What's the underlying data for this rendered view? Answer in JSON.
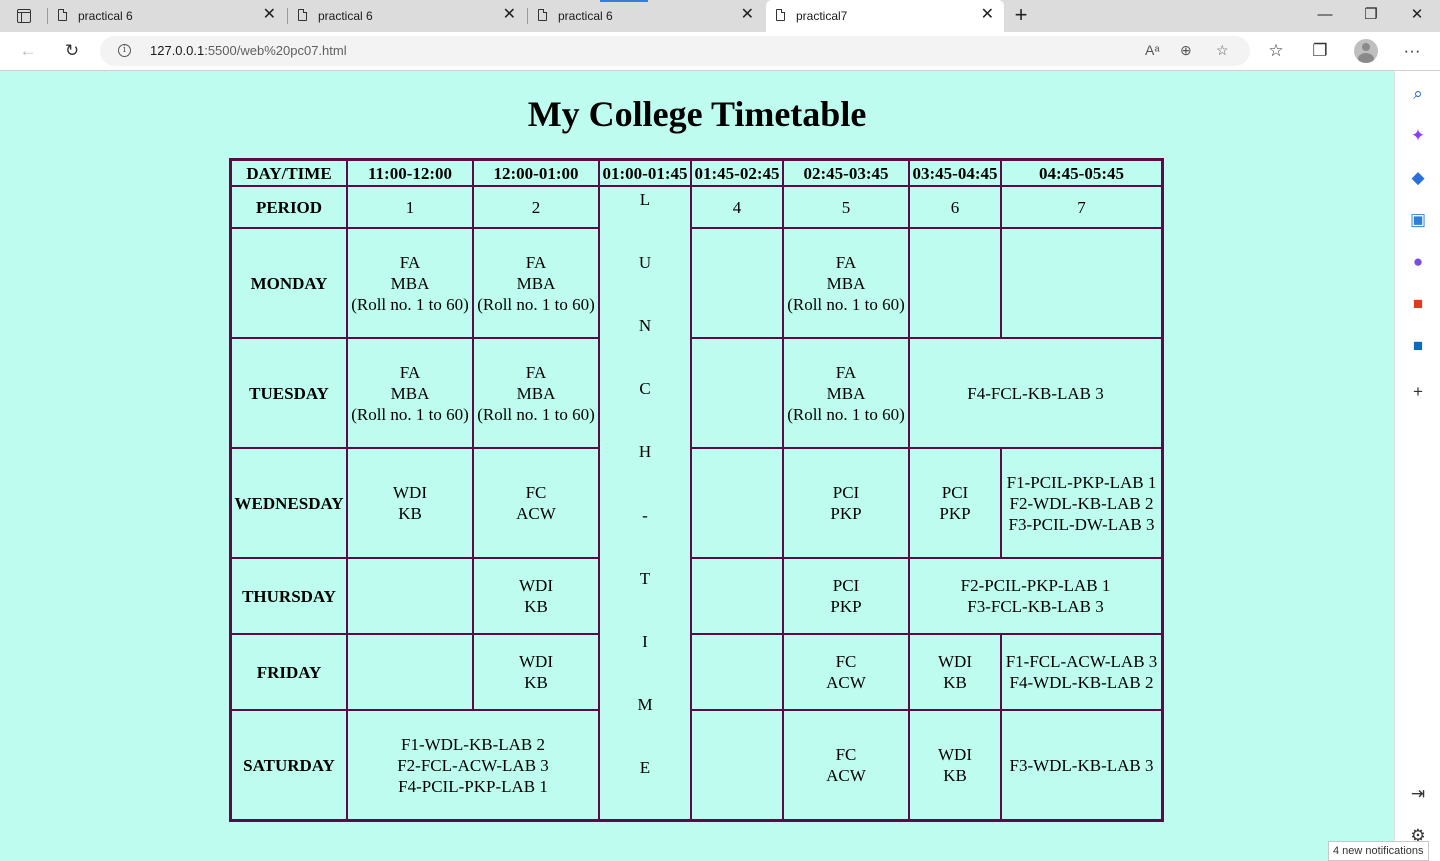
{
  "browser": {
    "tabs": [
      {
        "title": "practical 6",
        "close": "✕"
      },
      {
        "title": "practical 6",
        "close": "✕"
      },
      {
        "title": "practical 6",
        "close": "✕"
      },
      {
        "title": "practical7",
        "close": "✕",
        "active": true
      }
    ],
    "new_tab": "+",
    "window_controls": {
      "minimize": "—",
      "restore": "❐",
      "close": "✕"
    },
    "nav": {
      "back": "←",
      "refresh": "↻",
      "more": "···"
    },
    "url_host": "127.0.0.1",
    "url_rest": ":5500/web%20pc07.html",
    "url_icons": {
      "read_aloud": "Aᵃ",
      "zoom": "⊕",
      "favorite": "☆"
    },
    "toolbar_icons": {
      "favorites": "☆",
      "collections": "❐"
    },
    "sidebar_icons": [
      {
        "name": "search-icon",
        "glyph": "⌕",
        "color": "#1a5fd0"
      },
      {
        "name": "copilot-icon",
        "glyph": "✦",
        "color": "#8a3ffc"
      },
      {
        "name": "shopping-icon",
        "glyph": "◆",
        "color": "#2a6fdb"
      },
      {
        "name": "tools-icon",
        "glyph": "▣",
        "color": "#2f7fd6"
      },
      {
        "name": "games-icon",
        "glyph": "●",
        "color": "#7a4fd9"
      },
      {
        "name": "office-icon",
        "glyph": "■",
        "color": "#e03b1f"
      },
      {
        "name": "outlook-icon",
        "glyph": "■",
        "color": "#0f6cbd"
      },
      {
        "name": "add-icon",
        "glyph": "+",
        "color": "#333333"
      }
    ],
    "sidebar_bottom_icons": {
      "hide": "⇥",
      "settings": "⚙"
    },
    "notification": "4 new notifications",
    "colors": {
      "page_bg": "#bdfcee",
      "table_border": "#5a0c48",
      "tab_strip": "#dcdcdc"
    }
  },
  "page": {
    "title": "My College Timetable",
    "header": {
      "day_time": "DAY/TIME",
      "times": [
        "11:00-12:00",
        "12:00-01:00",
        "01:00-01:45",
        "01:45-02:45",
        "02:45-03:45",
        "03:45-04:45",
        "04:45-05:45"
      ],
      "period_label": "PERIOD",
      "periods": [
        "1",
        "2",
        "4",
        "5",
        "6",
        "7"
      ]
    },
    "lunch": [
      "L",
      "U",
      "N",
      "C",
      "H",
      "-",
      "T",
      "I",
      "M",
      "E"
    ],
    "days": {
      "monday": "MONDAY",
      "tuesday": "TUESDAY",
      "wednesday": "WEDNESDAY",
      "thursday": "THURSDAY",
      "friday": "FRIDAY",
      "saturday": "SATURDAY"
    },
    "cells": {
      "fa": [
        "FA",
        "MBA",
        "(Roll no. 1 to 60)"
      ],
      "tue_lab": "F4-FCL-KB-LAB 3",
      "wdi_kb": [
        "WDI",
        "KB"
      ],
      "fc_acw": [
        "FC",
        "ACW"
      ],
      "pci_pkp": [
        "PCI",
        "PKP"
      ],
      "wed_lab": [
        "F1-PCIL-PKP-LAB 1",
        "F2-WDL-KB-LAB 2",
        "F3-PCIL-DW-LAB 3"
      ],
      "thu_lab": [
        "F2-PCIL-PKP-LAB 1",
        "F3-FCL-KB-LAB 3"
      ],
      "fri_lab": [
        "F1-FCL-ACW-LAB 3",
        "F4-WDL-KB-LAB 2"
      ],
      "sat_lab": [
        "F1-WDL-KB-LAB 2",
        "F2-FCL-ACW-LAB 3",
        "F4-PCIL-PKP-LAB 1"
      ],
      "sat_last": "F3-WDL-KB-LAB 3"
    }
  }
}
